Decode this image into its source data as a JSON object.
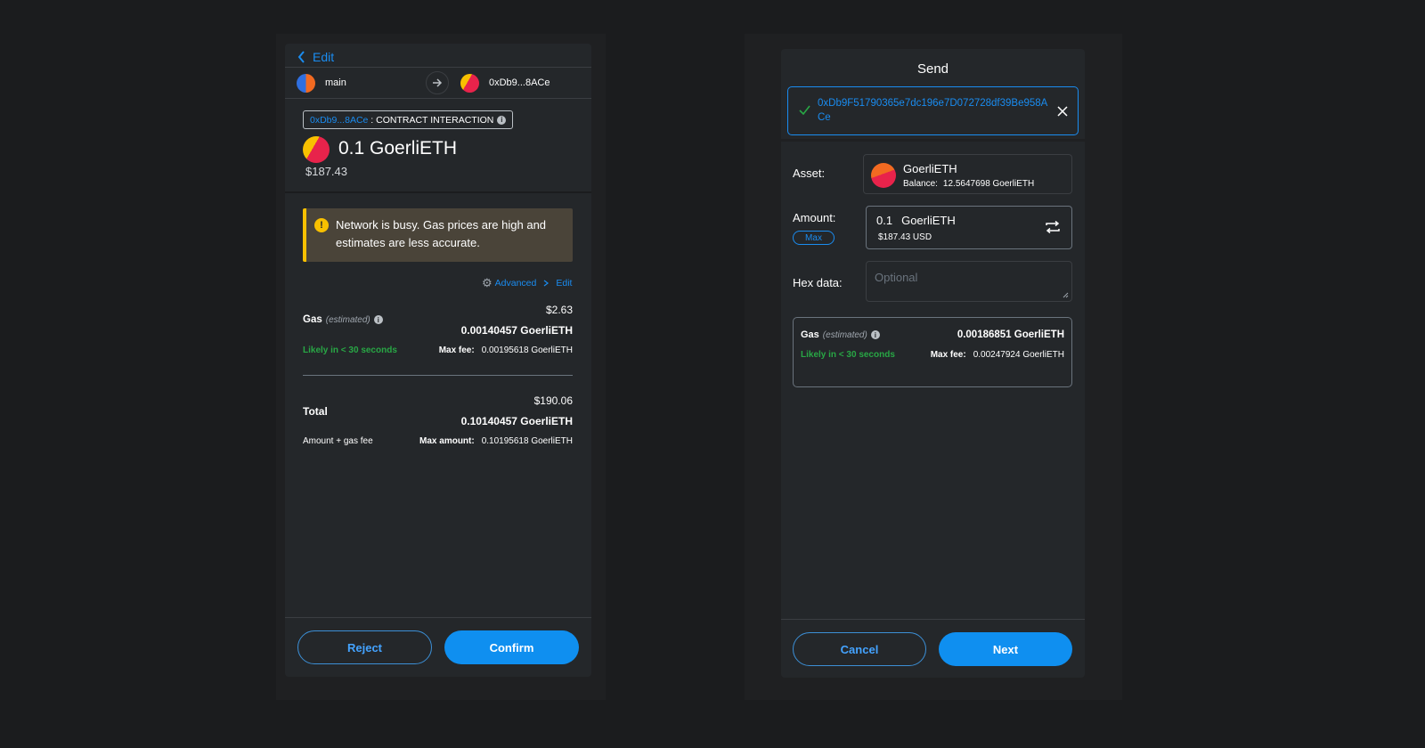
{
  "left": {
    "back_label": "Edit",
    "from_account": "main",
    "to_account": "0xDb9...8ACe",
    "contract_address": "0xDb9...8ACe",
    "contract_sep": " : ",
    "contract_label": "CONTRACT INTERACTION",
    "amount": "0.1 GoerliETH",
    "amount_usd": "$187.43",
    "warning_text": "Network is busy. Gas prices are high and estimates are less accurate.",
    "advanced_label": "Advanced",
    "edit_label": "Edit",
    "gas": {
      "label": "Gas",
      "qualifier": "(estimated)",
      "usd": "$2.63",
      "eth": "0.00140457 GoerliETH",
      "likely": "Likely in < 30 seconds",
      "max_fee_label": "Max fee:",
      "max_fee_value": "0.00195618 GoerliETH"
    },
    "total": {
      "label": "Total",
      "usd": "$190.06",
      "eth": "0.10140457 GoerliETH",
      "sub": "Amount + gas fee",
      "max_amount_label": "Max amount:",
      "max_amount_value": "0.10195618 GoerliETH"
    },
    "reject_label": "Reject",
    "confirm_label": "Confirm"
  },
  "right": {
    "title": "Send",
    "recipient_address": "0xDb9F51790365e7dc196e7D072728df39Be958ACe",
    "asset_label": "Asset:",
    "asset_name": "GoerliETH",
    "balance_label": "Balance:",
    "balance_value": "12.5647698 GoerliETH",
    "amount_label": "Amount:",
    "max_label": "Max",
    "amount_value": "0.1",
    "amount_unit": "GoerliETH",
    "amount_usd": "$187.43 USD",
    "hex_label": "Hex data:",
    "hex_placeholder": "Optional",
    "gas": {
      "label": "Gas",
      "qualifier": "(estimated)",
      "eth": "0.00186851 GoerliETH",
      "likely": "Likely in < 30 seconds",
      "max_fee_label": "Max fee:",
      "max_fee_value": "0.00247924 GoerliETH"
    },
    "cancel_label": "Cancel",
    "next_label": "Next"
  },
  "colors": {
    "background": "#1b1c1e",
    "panel": "#24272a",
    "accent": "#0f8ff0",
    "link": "#1a8cf0",
    "success": "#28a745",
    "warning_bar": "#f8c000"
  },
  "icons": [
    "chevron-left-icon",
    "arrow-right-icon",
    "info-icon",
    "warning-icon",
    "gear-icon",
    "chevron-right-icon",
    "check-icon",
    "close-icon",
    "swap-icon"
  ]
}
